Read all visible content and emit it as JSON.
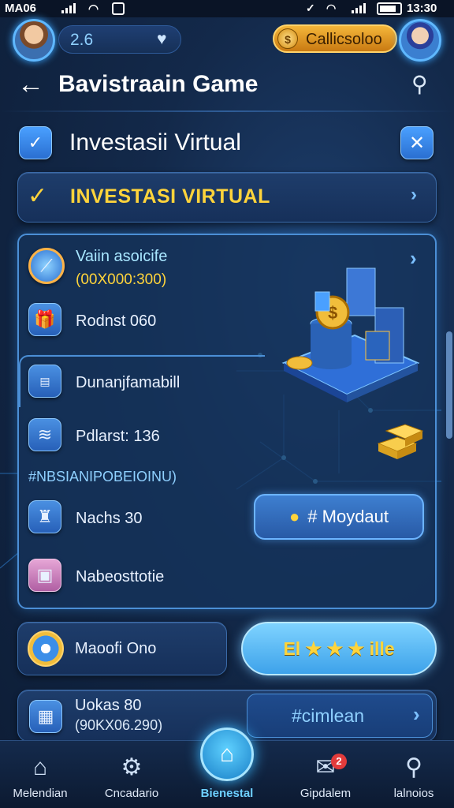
{
  "status_bar": {
    "carrier": "MA06",
    "time": "13:30"
  },
  "user_header": {
    "score": "2.6",
    "coin_label": "Callicsoloo"
  },
  "title_bar": {
    "title": "Bavistraain Game"
  },
  "section": {
    "title": "Investasii Virtual"
  },
  "banner": {
    "label": "INVESTASI VIRTUAL"
  },
  "main_panel": {
    "items": [
      {
        "label": "Vaiin asoicife",
        "sub": "(00X000:300)"
      },
      {
        "label": "Rodnst 060"
      },
      {
        "label": "Dunanjfamabill"
      },
      {
        "label": "Pdlarst: 136"
      }
    ],
    "section_tag": "#NBSIANIPOBEIOINU)",
    "items2": [
      {
        "label": "Nachs 30"
      },
      {
        "label": "Nabeosttotie"
      }
    ],
    "movement_button": "# Moydaut"
  },
  "bottom_row": {
    "left_label": "Maoofi Ono",
    "rating_label": "El ★ ★ ★ ille"
  },
  "last_row": {
    "label": "Uokas 80",
    "sub": "(90KX06.290)",
    "button": "#cimlean"
  },
  "nav": {
    "items": [
      {
        "label": "Melendian",
        "icon": "home-icon"
      },
      {
        "label": "Cncadario",
        "icon": "settings-icon"
      },
      {
        "label": "Bienestal",
        "icon": "gift-icon"
      },
      {
        "label": "Gipdalem",
        "icon": "mail-icon",
        "badge": "2"
      },
      {
        "label": "lalnoios",
        "icon": "search-icon"
      }
    ]
  },
  "colors": {
    "accent": "#4b8fd6",
    "gold": "#f4b63a",
    "banner_text": "#ffd43b",
    "background": "#13294a"
  }
}
